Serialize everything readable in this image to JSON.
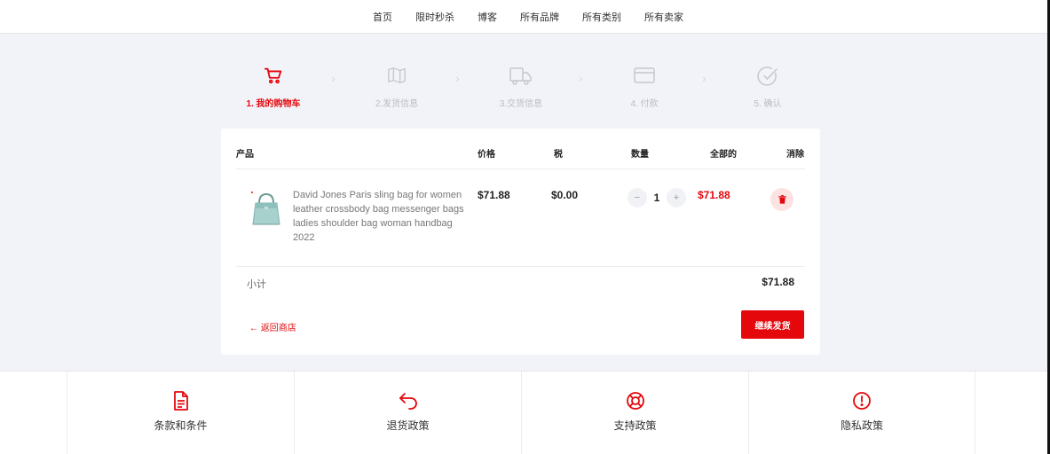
{
  "nav": {
    "items": [
      "首页",
      "限时秒杀",
      "博客",
      "所有品牌",
      "所有类别",
      "所有卖家"
    ]
  },
  "steps": [
    {
      "label": "1. 我的购物车",
      "icon": "cart-icon",
      "active": true
    },
    {
      "label": "2.发货信息",
      "icon": "map-icon",
      "active": false
    },
    {
      "label": "3.交货信息",
      "icon": "truck-icon",
      "active": false
    },
    {
      "label": "4. 付款",
      "icon": "card-icon",
      "active": false
    },
    {
      "label": "5. 确认",
      "icon": "check-circle-icon",
      "active": false
    }
  ],
  "table": {
    "headers": {
      "product": "产品",
      "price": "价格",
      "tax": "税",
      "quantity": "数量",
      "total": "全部的",
      "remove": "消除"
    },
    "rows": [
      {
        "name": "David Jones Paris sling bag for women leather crossbody bag messenger bags ladies shoulder bag woman handbag 2022",
        "price": "$71.88",
        "tax": "$0.00",
        "quantity": "1",
        "total": "$71.88"
      }
    ]
  },
  "summary": {
    "subtotal_label": "小计",
    "subtotal_value": "$71.88"
  },
  "actions": {
    "back_label": "← 返回商店",
    "continue_label": "继续发货"
  },
  "footer": {
    "items": [
      {
        "label": "条款和条件",
        "icon": "document-icon"
      },
      {
        "label": "退货政策",
        "icon": "return-arrow-icon"
      },
      {
        "label": "支持政策",
        "icon": "lifebuoy-icon"
      },
      {
        "label": "隐私政策",
        "icon": "alert-circle-icon"
      }
    ]
  },
  "colors": {
    "accent": "#e4070c",
    "muted": "#b9bcc4",
    "background": "#f2f3f8"
  }
}
